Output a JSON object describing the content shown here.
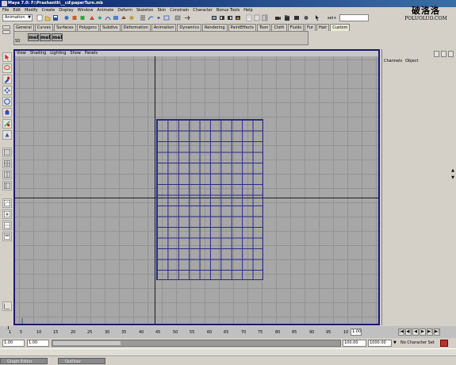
{
  "window": {
    "title": "Maya 7.0: F:\\Prashanth\\__cd\\paperTurn.mb"
  },
  "watermark": {
    "cn": "破洛洛",
    "url": "POLUOLUO.COM"
  },
  "menubar": [
    "File",
    "Edit",
    "Modify",
    "Create",
    "Display",
    "Window",
    "Animate",
    "Deform",
    "Skeleton",
    "Skin",
    "Constrain",
    "Character",
    "Bonus Tools",
    "Help"
  ],
  "statusline": {
    "mode": "Animation",
    "sel_label": "sel+",
    "sel_value": ""
  },
  "shelf": {
    "tabs": [
      "General",
      "Curves",
      "Surfaces",
      "Polygons",
      "Subdivs",
      "Deformation",
      "Animation",
      "Dynamics",
      "Rendering",
      "PaintEffects",
      "Toon",
      "Cloth",
      "Fluids",
      "Fur",
      "Hair",
      "Custom"
    ],
    "active_tab": "Custom",
    "buttons": [
      "mel",
      "mel",
      "mel"
    ],
    "label": "SS"
  },
  "panel": {
    "menu": [
      "View",
      "Shading",
      "Lighting",
      "Show",
      "Panels"
    ],
    "view_name": "top"
  },
  "channelbox": {
    "menu": [
      "Channels",
      "Object"
    ]
  },
  "timeline": {
    "ticks": [
      "1",
      "5",
      "10",
      "15",
      "20",
      "25",
      "30",
      "35",
      "40",
      "45",
      "50",
      "55",
      "60",
      "65",
      "70",
      "75",
      "80",
      "85",
      "90",
      "95",
      "10"
    ],
    "current_frame": "1.00",
    "playback": [
      "|◀",
      "◀|",
      "◀",
      "▶",
      "▶|",
      "▶|"
    ]
  },
  "range": {
    "start": "1.00",
    "inner_start": "1.00",
    "inner_end": "100.00",
    "end": "1000.00",
    "character_set": "No Character Set"
  },
  "taskbar": {
    "items": [
      "Graph Editor",
      "Outliner"
    ]
  }
}
